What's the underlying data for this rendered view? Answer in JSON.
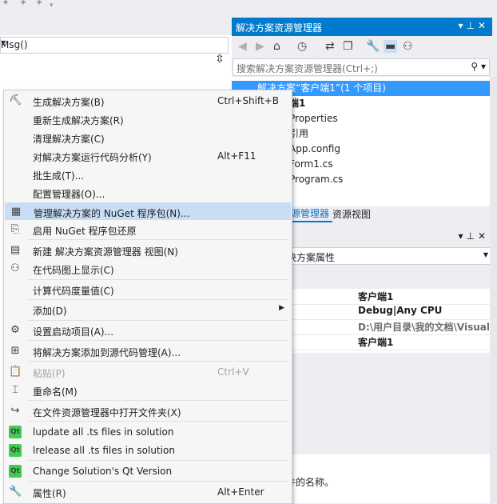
{
  "top_combo": {
    "value": "Msg()"
  },
  "solution_explorer": {
    "title": "解决方案资源管理器",
    "search_placeholder": "搜索解决方案资源管理器(Ctrl+;)",
    "tree": [
      {
        "label": "解决方案“客户端1”(1 个项目)",
        "selected": true
      },
      {
        "label": "端1"
      },
      {
        "label": "Properties"
      },
      {
        "label": "引用"
      },
      {
        "label": "App.config"
      },
      {
        "label": "Form1.cs"
      },
      {
        "label": "Program.cs"
      }
    ],
    "tabs": [
      "源管理器",
      "资源视图"
    ]
  },
  "properties": {
    "object_combo": "决方案属性",
    "rows": [
      "客户端1",
      "Debug|Any CPU",
      "D:\\用户目录\\我的文档\\Visual",
      "客户端1"
    ],
    "description": "件的名称。"
  },
  "context_menu": {
    "items": [
      {
        "icon": "build-icon",
        "label": "生成解决方案(B)",
        "shortcut": "Ctrl+Shift+B"
      },
      {
        "icon": "",
        "label": "重新生成解决方案(R)",
        "shortcut": ""
      },
      {
        "icon": "",
        "label": "清理解决方案(C)",
        "shortcut": ""
      },
      {
        "icon": "",
        "label": "对解决方案运行代码分析(Y)",
        "shortcut": "Alt+F11"
      },
      {
        "icon": "",
        "label": "批生成(T)...",
        "shortcut": ""
      },
      {
        "icon": "",
        "label": "配置管理器(O)...",
        "shortcut": ""
      },
      {
        "icon": "nuget-icon",
        "label": "管理解决方案的 NuGet 程序包(N)...",
        "shortcut": "",
        "highlighted": true
      },
      {
        "icon": "restore-icon",
        "label": "启用 NuGet 程序包还原",
        "shortcut": ""
      },
      {
        "icon": "new-view-icon",
        "label": "新建 解决方案资源管理器 视图(N)",
        "shortcut": ""
      },
      {
        "icon": "code-map-icon",
        "label": "在代码图上显示(C)",
        "shortcut": ""
      },
      {
        "icon": "",
        "label": "计算代码度量值(C)",
        "shortcut": ""
      },
      {
        "icon": "",
        "label": "添加(D)",
        "shortcut": "",
        "submenu": true
      },
      {
        "icon": "gear-icon",
        "label": "设置启动项目(A)...",
        "shortcut": ""
      },
      {
        "icon": "source-control-icon",
        "label": "将解决方案添加到源代码管理(A)...",
        "shortcut": ""
      },
      {
        "icon": "paste-icon",
        "label": "粘贴(P)",
        "shortcut": "Ctrl+V",
        "disabled": true
      },
      {
        "icon": "rename-icon",
        "label": "重命名(M)",
        "shortcut": ""
      },
      {
        "icon": "open-folder-icon",
        "label": "在文件资源管理器中打开文件夹(X)",
        "shortcut": ""
      },
      {
        "icon": "qt-icon",
        "label": "lupdate all .ts files in solution",
        "shortcut": ""
      },
      {
        "icon": "qt-icon",
        "label": "lrelease all .ts files in solution",
        "shortcut": ""
      },
      {
        "icon": "qt-icon",
        "label": "Change Solution's Qt Version",
        "shortcut": ""
      },
      {
        "icon": "wrench-icon",
        "label": "属性(R)",
        "shortcut": "Alt+Enter"
      }
    ],
    "qt_glyph": "Qt"
  }
}
